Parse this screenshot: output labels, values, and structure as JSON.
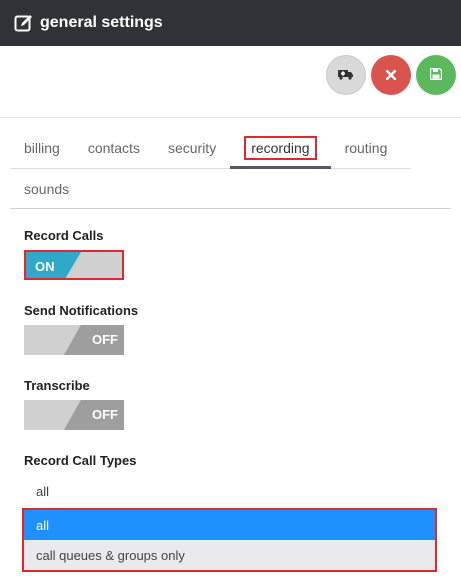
{
  "header": {
    "title": "general settings",
    "icon": "edit-icon"
  },
  "toolbar": {
    "buttons": [
      {
        "icon": "ambulance-icon",
        "color": "#d9d9d9"
      },
      {
        "icon": "close-icon",
        "color": "#d9534f"
      },
      {
        "icon": "save-icon",
        "color": "#5cb85c"
      }
    ]
  },
  "tabs": {
    "items": [
      "billing",
      "contacts",
      "security",
      "recording",
      "routing",
      "sounds"
    ],
    "active": "recording"
  },
  "fields": {
    "record_calls": {
      "label": "Record Calls",
      "state": "ON"
    },
    "send_notifications": {
      "label": "Send Notifications",
      "state": "OFF"
    },
    "transcribe": {
      "label": "Transcribe",
      "state": "OFF"
    },
    "record_call_types": {
      "label": "Record Call Types",
      "value": "all",
      "options": [
        "all",
        "call queues & groups only"
      ],
      "selected_option": "all"
    }
  },
  "colors": {
    "accent": "#2fa8c9",
    "highlight": "#e0282e",
    "selected_option": "#1e90ff",
    "header_bg": "#2f3236"
  }
}
